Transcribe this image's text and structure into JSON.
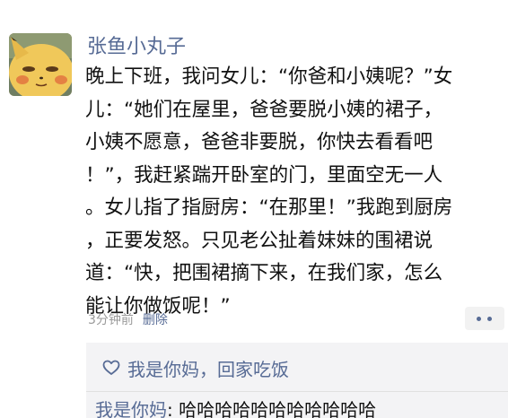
{
  "post": {
    "username": "张鱼小丸子",
    "avatar": "cartoon-pikachu-avatar",
    "lines": [
      "晚上下班，我问女儿：“你爸和小姨呢？”女",
      "儿：“她们在屋里，爸爸要脱小姨的裙子，",
      "小姨不愿意，爸爸非要脱，你快去看看吧",
      "！”，我赶紧踹开卧室的门，里面空无一人",
      "。女儿指了指厨房：“在那里！”我跑到厨房",
      "，正要发怒。只见老公扯着妹妹的围裙说",
      "道：“快，把围裙摘下来，在我们家，怎么",
      "能让你做饭呢！”"
    ],
    "time": "3分钟前",
    "delete_label": "删除"
  },
  "likes": {
    "icon": "heart-outline-icon",
    "names": "我是你妈，回家吃饭"
  },
  "comments": [
    {
      "author": "我是你妈",
      "separator": ": ",
      "text": "哈哈哈哈哈哈哈哈哈哈哈"
    }
  ],
  "colors": {
    "link": "#576b95",
    "text": "#111111",
    "meta": "#9a9a9a",
    "comment_bg": "#f3f3f5"
  }
}
